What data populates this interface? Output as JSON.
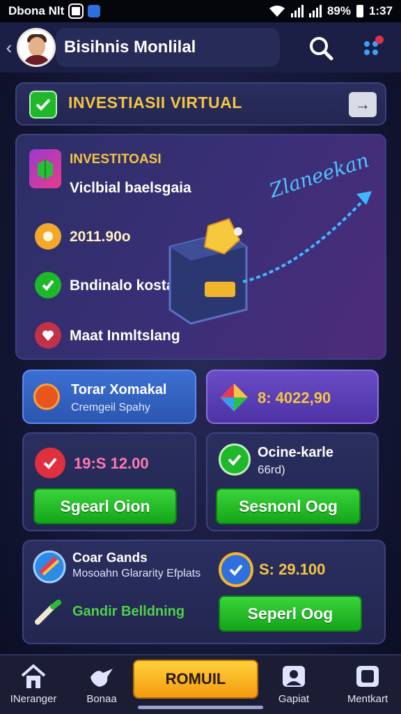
{
  "status_bar": {
    "carrier": "Dbona Nlt",
    "battery": "89%",
    "time": "1:37"
  },
  "header": {
    "back_glyph": "‹",
    "title": "Bisihnis Monlilal"
  },
  "banner": {
    "title": "INVESTIASII VIRTUAL",
    "arrow_glyph": "→"
  },
  "main_card": {
    "heading": "INVESTITOASI",
    "subheading": "Viclbial baelsgaia",
    "amount": "2011.90o",
    "status": "Bndinalo kostaal",
    "action": "Maat Inmltslang",
    "handwriting": "Zlaneekan"
  },
  "tile_top_left": {
    "title": "Torar Xomakal",
    "subtitle": "Cremgeil Spahy"
  },
  "tile_top_right": {
    "value": "8: 4022,90"
  },
  "tile_mid_left": {
    "value": "19:S 12.00",
    "button": "Sgearl Oion"
  },
  "tile_mid_right": {
    "title": "Ocine-karle",
    "subtitle": "66rd)",
    "button": "Sesnonl Oog"
  },
  "bottom_card": {
    "title": "Coar Gands",
    "subtitle": "Mosoahn Glararity Efplats",
    "value": "S: 29.100",
    "link": "Gandir Belldning",
    "button": "Seperl Oog"
  },
  "nav": {
    "items": [
      "INeranger",
      "Bonaa",
      "Gapiat",
      "Mentkart"
    ],
    "central": "ROMUIL"
  },
  "colors": {
    "accent_gold": "#f5c542",
    "green": "#1fb82a",
    "purple": "#5b3fb0",
    "blue": "#3a6fd0"
  }
}
